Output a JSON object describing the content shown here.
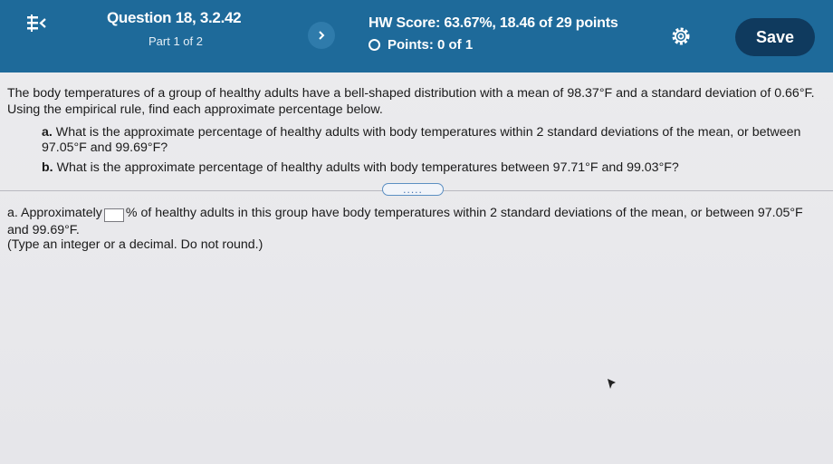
{
  "header": {
    "question_title": "Question 18, 3.2.42",
    "question_part": "Part 1 of 2",
    "hw_score": "HW Score: 63.67%, 18.46 of 29 points",
    "points": "Points: 0 of 1",
    "save_label": "Save"
  },
  "problem": {
    "intro": "The body temperatures of a group of healthy adults have a bell-shaped distribution with a mean of 98.37°F and a standard deviation of 0.66°F. Using the empirical rule, find each approximate percentage below.",
    "part_a_label": "a.",
    "part_a_text": "What is the approximate percentage of healthy adults with body temperatures within 2 standard deviations of the mean, or between 97.05°F and 99.69°F?",
    "part_b_label": "b.",
    "part_b_text": "What is the approximate percentage of healthy adults with body temperatures between 97.71°F and 99.03°F?"
  },
  "expand_label": ".....",
  "answer": {
    "prefix": "a. Approximately",
    "input_value": "",
    "suffix": "% of healthy adults in this group have body temperatures within 2 standard deviations of the mean, or between 97.05°F and 99.69°F.",
    "hint": "(Type an integer or a decimal. Do not round.)"
  },
  "icons": {
    "menu": "list-menu-icon",
    "next": "chevron-right-icon",
    "settings": "gear-icon",
    "points": "circle-outline-icon"
  },
  "colors": {
    "header_bg": "#1e6a9a",
    "save_bg": "#0f3a5e",
    "page_bg": "#e9e9ec"
  }
}
